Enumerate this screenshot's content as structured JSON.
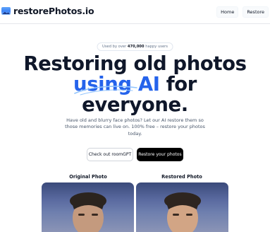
{
  "header": {
    "brand": "restorePhotos.io",
    "brand_icon": "photo-landscape-icon",
    "nav": {
      "home": "Home",
      "restore": "Restore"
    }
  },
  "hero": {
    "badge_prefix": "Used by over",
    "badge_count": "470,000",
    "badge_suffix": "happy users",
    "title_line1": "Restoring old photos",
    "title_accent": "using AI",
    "title_after_accent": " for",
    "title_line3": "everyone.",
    "description": "Have old and blurry face photos? Let our AI restore them so those memories can live on. 100% free – restore your photos today.",
    "accent_color": "#2563eb"
  },
  "actions": {
    "secondary": "Check out roomGPT",
    "primary": "Restore your photos"
  },
  "comparison": {
    "original_label": "Original Photo",
    "restored_label": "Restored Photo"
  }
}
